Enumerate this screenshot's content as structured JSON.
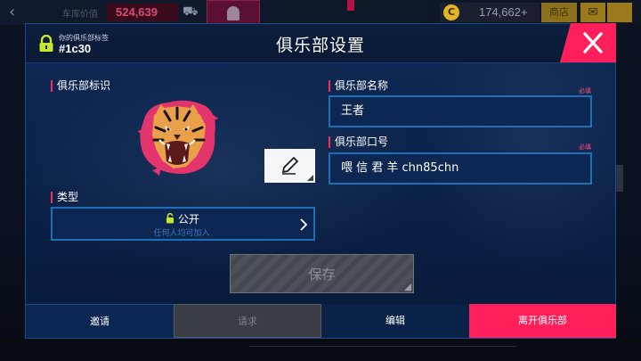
{
  "background_hud": {
    "label": "车库价值",
    "money": "524,639",
    "coins": "174,662+",
    "shop_label": "商店"
  },
  "dialog": {
    "title": "俱乐部设置",
    "club_tag_caption": "你的俱乐部标签",
    "club_tag_value": "#1c30"
  },
  "emblem": {
    "label": "俱乐部标识",
    "icon": "tiger-head-icon"
  },
  "name_field": {
    "label": "俱乐部名称",
    "required": "必填",
    "value": "王者"
  },
  "motto_field": {
    "label": "俱乐部口号",
    "required": "必填",
    "value": "喂 信 君 羊 chn85chn"
  },
  "type_field": {
    "label": "类型",
    "value": "公开",
    "description": "任何人均可加入"
  },
  "save_button": {
    "label": "保存",
    "enabled": false
  },
  "tabs": [
    {
      "label": "邀请"
    },
    {
      "label": "请求"
    },
    {
      "label": "编辑"
    },
    {
      "label": "离开俱乐部"
    }
  ],
  "colors": {
    "accent": "#ff1f5b",
    "lock_green": "#c8e62a",
    "dialog_bg": "#0a2148",
    "input_border": "#1d6fb8"
  }
}
